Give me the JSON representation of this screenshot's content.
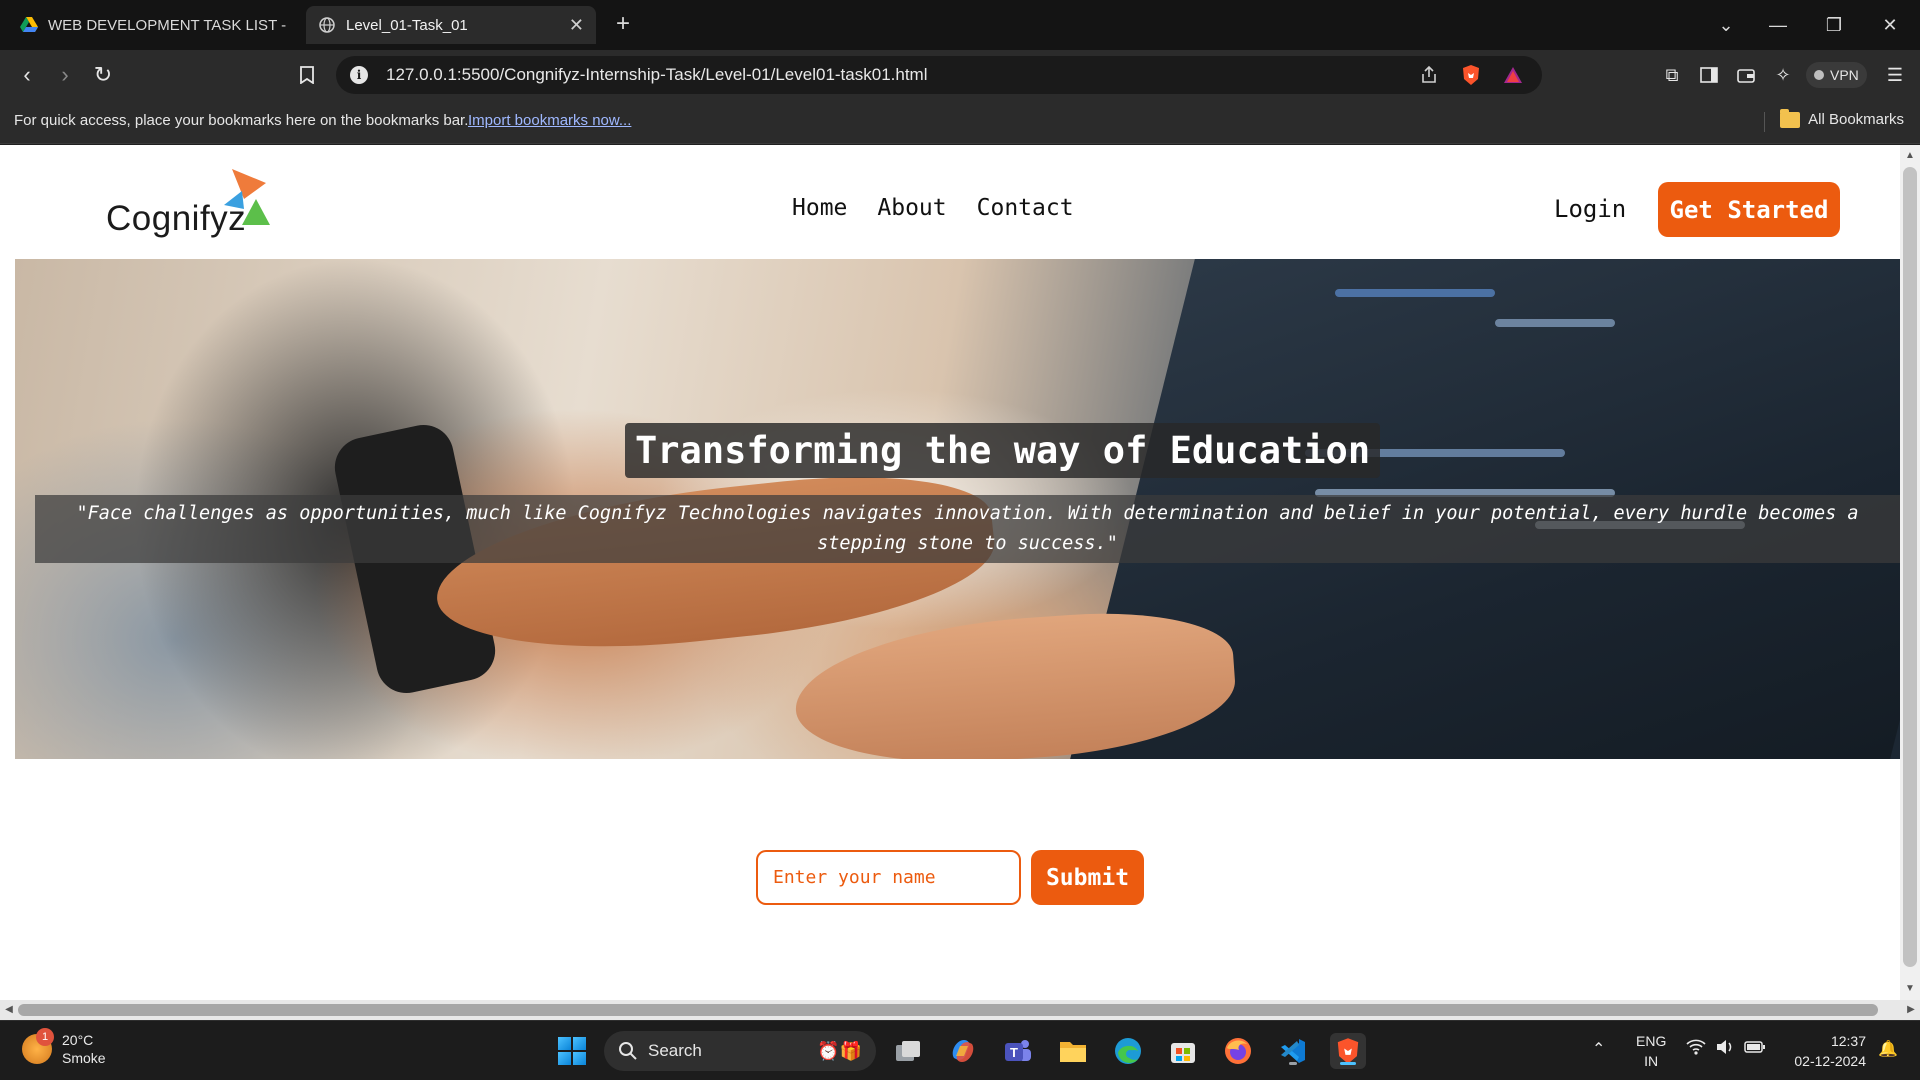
{
  "browser": {
    "tabs": [
      {
        "label": "WEB DEVELOPMENT TASK LIST - Go",
        "active": false
      },
      {
        "label": "Level_01-Task_01",
        "active": true
      }
    ],
    "url": "127.0.0.1:5500/Congnifyz-Internship-Task/Level-01/Level01-task01.html",
    "vpn_label": "VPN",
    "bookmarks_hint": "For quick access, place your bookmarks here on the bookmarks bar.",
    "import_link": "Import bookmarks now...",
    "all_bookmarks": "All Bookmarks"
  },
  "page": {
    "logo_text": "Cognifyz",
    "nav": [
      "Home",
      "About",
      "Contact"
    ],
    "login": "Login",
    "cta": "Get Started",
    "hero_title": "Transforming the way of Education",
    "hero_quote": "\"Face challenges as opportunities, much like Cognifyz Technologies navigates innovation. With determination and belief in your potential, every hurdle becomes a stepping stone to success.\"",
    "name_placeholder": "Enter your name",
    "submit": "Submit",
    "accent_color": "#ec5b0f"
  },
  "taskbar": {
    "weather_temp": "20°C",
    "weather_desc": "Smoke",
    "weather_badge": "1",
    "search_label": "Search",
    "lang_top": "ENG",
    "lang_bottom": "IN",
    "time": "12:37",
    "date": "02-12-2024"
  }
}
